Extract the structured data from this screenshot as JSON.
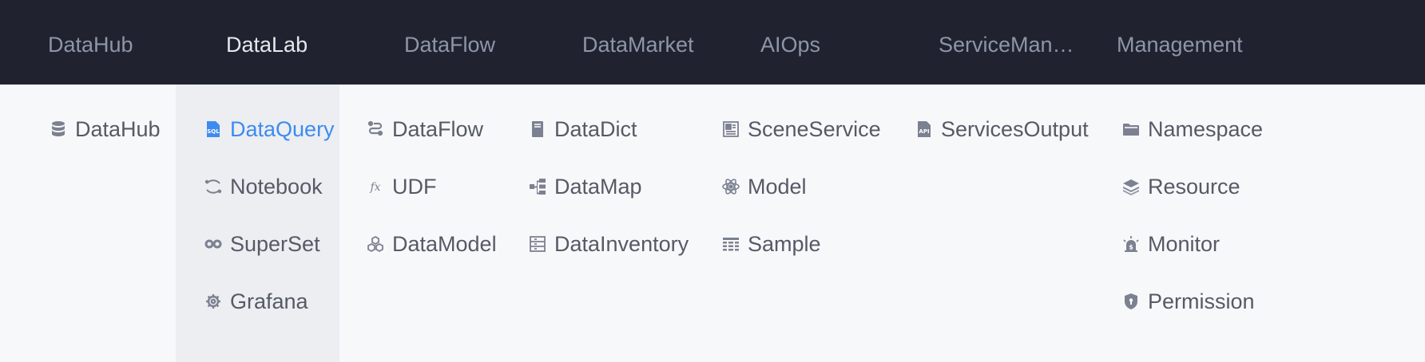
{
  "topnav": {
    "items": [
      {
        "label": "DataHub",
        "active": false
      },
      {
        "label": "DataLab",
        "active": true
      },
      {
        "label": "DataFlow",
        "active": false
      },
      {
        "label": "DataMarket",
        "active": false
      },
      {
        "label": "AIOps",
        "active": false
      },
      {
        "label": "ServiceMan…",
        "active": false
      },
      {
        "label": "Management",
        "active": false
      }
    ]
  },
  "menu": {
    "datahub": [
      {
        "label": "DataHub",
        "icon": "database-icon"
      }
    ],
    "datalab": [
      {
        "label": "DataQuery",
        "icon": "sql-file-icon",
        "active": true
      },
      {
        "label": "Notebook",
        "icon": "notebook-icon"
      },
      {
        "label": "SuperSet",
        "icon": "infinity-icon"
      },
      {
        "label": "Grafana",
        "icon": "grafana-gear-icon"
      }
    ],
    "dataflow": [
      {
        "label": "DataFlow",
        "icon": "flow-icon"
      },
      {
        "label": "UDF",
        "icon": "function-icon"
      },
      {
        "label": "DataModel",
        "icon": "cubes-icon"
      }
    ],
    "datamarket": [
      {
        "label": "DataDict",
        "icon": "book-icon"
      },
      {
        "label": "DataMap",
        "icon": "tree-map-icon"
      },
      {
        "label": "DataInventory",
        "icon": "inventory-icon"
      }
    ],
    "aiops": [
      {
        "label": "SceneService",
        "icon": "layout-icon"
      },
      {
        "label": "Model",
        "icon": "atom-icon"
      },
      {
        "label": "Sample",
        "icon": "table-icon"
      }
    ],
    "servicemanagement": [
      {
        "label": "ServicesOutput",
        "icon": "api-file-icon"
      }
    ],
    "management": [
      {
        "label": "Namespace",
        "icon": "folder-icon"
      },
      {
        "label": "Resource",
        "icon": "layers-icon"
      },
      {
        "label": "Monitor",
        "icon": "alarm-icon"
      },
      {
        "label": "Permission",
        "icon": "shield-lock-icon"
      }
    ]
  },
  "colors": {
    "topbar_bg": "#20232f",
    "nav_text": "#8e95a8",
    "nav_active": "#e6e8ee",
    "menu_text": "#555a66",
    "accent": "#3e8bef",
    "panel_bg": "#f7f8fa"
  }
}
